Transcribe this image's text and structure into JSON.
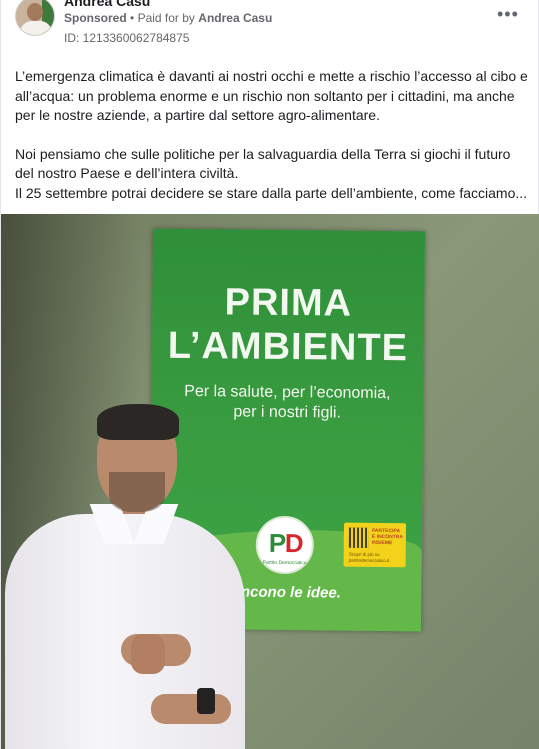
{
  "post": {
    "author": "Andrea Casu",
    "sponsored": "Sponsored",
    "separator": "•",
    "paid_for_by_label": "Paid for by",
    "payer": "Andrea Casu",
    "ad_id": "ID: 1213360062784875",
    "more_icon": "more-horizontal-icon",
    "text": {
      "paragraph1": "L’emergenza climatica è davanti ai nostri occhi e mette a rischio l’accesso al cibo e all’acqua: un problema enorme e un rischio non soltanto per i cittadini, ma anche per le nostre aziende, a partire dal settore agro-alimentare.",
      "paragraph2": "Noi pensiamo che sulle politiche per la salvaguardia della Terra si giochi il futuro del nostro Paese e dell’intera civiltà.",
      "paragraph3": "Il 25 settembre potrai decidere se stare dalla parte dell’ambiente, come facciamo..."
    }
  },
  "image": {
    "poster_title_line1": "PRIMA",
    "poster_title_line2": "L’AMBIENTE",
    "poster_sub_line1": "Per la salute, per l’economia,",
    "poster_sub_line2": "per i nostri figli.",
    "slogan": "Vincono le idee.",
    "logo_letters_p": "P",
    "logo_letters_d": "D",
    "logo_caption": "Partito Democratico",
    "qr_label": "PARTECIPA E INCONTRA INSIEME",
    "qr_url": "Scopri di più su partitodemocratico.it",
    "colors": {
      "poster_green": "#3a9d40",
      "pd_green": "#2e8b3a",
      "pd_red": "#d8262d",
      "qr_yellow": "#f2d21b"
    }
  }
}
